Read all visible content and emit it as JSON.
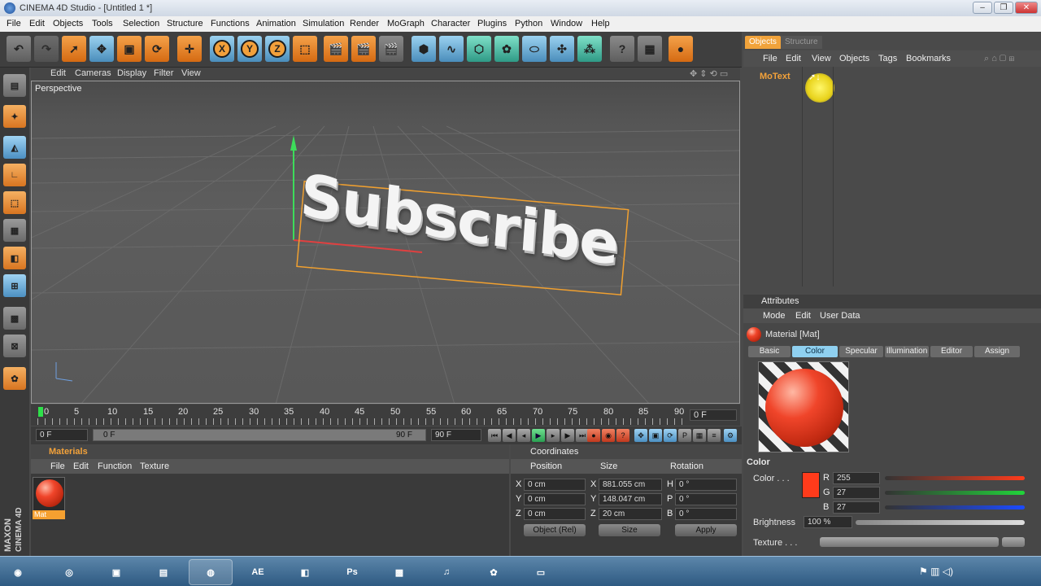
{
  "window": {
    "title": "CINEMA 4D Studio - [Untitled 1 *]",
    "min": "–",
    "max": "❐",
    "close": "✕"
  },
  "menubar": [
    "File",
    "Edit",
    "Objects",
    "Tools",
    "Selection",
    "Structure",
    "Functions",
    "Animation",
    "Simulation",
    "Render",
    "MoGraph",
    "Character",
    "Plugins",
    "Python",
    "Window",
    "Help"
  ],
  "toolbar": {
    "axis_x": "X",
    "axis_y": "Y",
    "axis_z": "Z",
    "icons": [
      "undo-icon",
      "redo-icon",
      "live-select-icon",
      "move-icon",
      "scale-icon",
      "rotate-icon",
      "add-object-icon",
      "x-axis-lock-icon",
      "y-axis-lock-icon",
      "z-axis-lock-icon",
      "coord-system-icon",
      "render-view-icon",
      "render-picture-viewer-icon",
      "render-settings-icon",
      "cube-icon",
      "spline-icon",
      "nurbs-icon",
      "array-icon",
      "deformer-icon",
      "scene-icon",
      "environment-icon",
      "light-icon",
      "camera-icon",
      "render-icon"
    ]
  },
  "viewport": {
    "menu": [
      "Edit",
      "Cameras",
      "Display",
      "Filter",
      "View"
    ],
    "label": "Perspective",
    "text3d": "Subscribe"
  },
  "timeline": {
    "ticks": [
      "0",
      "5",
      "10",
      "15",
      "20",
      "25",
      "30",
      "35",
      "40",
      "45",
      "50",
      "55",
      "60",
      "65",
      "70",
      "75",
      "80",
      "85",
      "90"
    ],
    "frame_display": "0 F",
    "start": "0 F",
    "range_start": "0 F",
    "range_end": "90 F",
    "end": "90 F"
  },
  "materials": {
    "title": "Materials",
    "menu": [
      "File",
      "Edit",
      "Function",
      "Texture"
    ],
    "items": [
      {
        "label": "Mat"
      }
    ]
  },
  "coordinates": {
    "title": "Coordinates",
    "columns": [
      "Position",
      "Size",
      "Rotation"
    ],
    "rows": [
      {
        "axis": "X",
        "pos": "0 cm",
        "size_axis": "X",
        "size": "881.055 cm",
        "rot_axis": "H",
        "rot": "0 °"
      },
      {
        "axis": "Y",
        "pos": "0 cm",
        "size_axis": "Y",
        "size": "148.047 cm",
        "rot_axis": "P",
        "rot": "0 °"
      },
      {
        "axis": "Z",
        "pos": "0 cm",
        "size_axis": "Z",
        "size": "20 cm",
        "rot_axis": "B",
        "rot": "0 °"
      }
    ],
    "mode": "Object (Rel)",
    "size_mode": "Size",
    "apply": "Apply"
  },
  "objects": {
    "tabs": [
      "Objects",
      "Structure"
    ],
    "menu": [
      "File",
      "Edit",
      "View",
      "Objects",
      "Tags",
      "Bookmarks"
    ],
    "items": [
      {
        "name": "MoText"
      }
    ]
  },
  "attributes": {
    "title": "Attributes",
    "menu": [
      "Mode",
      "Edit",
      "User Data"
    ],
    "material": "Material [Mat]",
    "tabs": [
      "Basic",
      "Color",
      "Specular",
      "Illumination",
      "Editor",
      "Assign"
    ],
    "section": "Color",
    "color_label": "Color . . .",
    "r": "255",
    "g": "27",
    "b": "27",
    "brightness_label": "Brightness",
    "brightness": "100 %",
    "texture_label": "Texture . . .",
    "swatch_color": "#ff1b1b"
  },
  "taskbar": {
    "apps": [
      "start-icon",
      "chrome-icon",
      "terminal-icon",
      "notes-icon",
      "cinema4d-icon",
      "after-effects-icon",
      "paint-icon",
      "photoshop-icon",
      "minecraft-icon",
      "itunes-icon",
      "paint-palette-icon",
      "document-icon"
    ],
    "ae_label": "AE",
    "ps_label": "Ps"
  },
  "brand": {
    "line1": "MAXON",
    "line2": "CINEMA 4D"
  }
}
